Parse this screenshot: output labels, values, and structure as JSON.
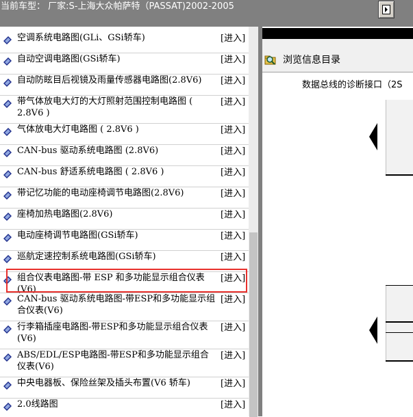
{
  "header": {
    "title": "当前车型： 厂家:S-上海大众帕萨特（PASSAT)2002-2005",
    "button_icon": "page-forward-icon"
  },
  "list": {
    "enter_label": "[进入]",
    "items": [
      {
        "label": "空调系统电路图(GLi、GSi轿车)"
      },
      {
        "label": "自动空调电路图(GSi轿车)"
      },
      {
        "label": "自动防眩目后视镜及雨量传感器电路图(2.8V6)"
      },
      {
        "label": "带气体放电大灯的大灯照射范围控制电路图 ( 2.8V6 )"
      },
      {
        "label": "气体放电大灯电路图 ( 2.8V6 )"
      },
      {
        "label": "CAN-bus 驱动系统电路图 (2.8V6)"
      },
      {
        "label": "CAN-bus 舒适系统电路图 ( 2.8V6 )"
      },
      {
        "label": "带记忆功能的电动座椅调节电路图(2.8V6)"
      },
      {
        "label": "座椅加热电路图(2.8V6)"
      },
      {
        "label": "电动座椅调节电路图(GSi轿车)"
      },
      {
        "label": "巡航定速控制系统电路图(GSi轿车)"
      },
      {
        "label": "组合仪表电路图-带 ESP 和多功能显示组合仪表(V6)"
      },
      {
        "label": "CAN-bus 驱动系统电路图-带ESP和多功能显示组合仪表(V6)"
      },
      {
        "label": "行李箱插座电路图-带ESP和多功能显示组合仪表(V6)"
      },
      {
        "label": "ABS/EDL/ESP电路图-带ESP和多功能显示组合仪表(V6)"
      },
      {
        "label": "中央电器板、保险丝架及插头布置(V6 轿车)"
      },
      {
        "label": "2.0线路图"
      }
    ]
  },
  "right_panel": {
    "browse_label": "浏览信息目录",
    "browse_icon": "magnifier-folder-icon",
    "partial_text": "数据总线的诊断接口（2S"
  },
  "colors": {
    "header_bg": "#808080",
    "highlight": "#e8302c",
    "item_icon": "#1f2f8c"
  }
}
